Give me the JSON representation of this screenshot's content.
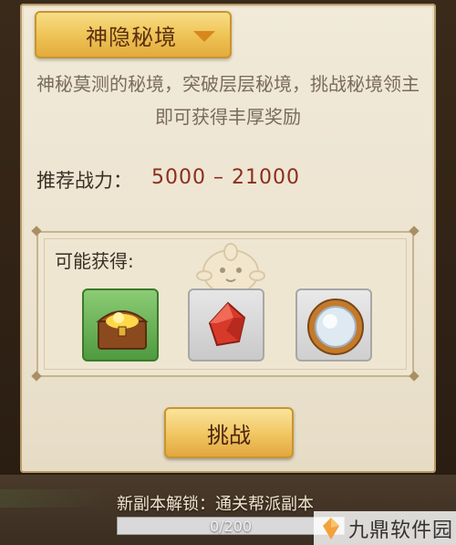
{
  "dialog": {
    "title": "神隐秘境",
    "description": "神秘莫测的秘境，突破层层秘境，挑战秘境领主即可获得丰厚奖励"
  },
  "power": {
    "label": "推荐战力：",
    "value": "5000 – 21000"
  },
  "rewards": {
    "label": "可能获得:",
    "items": [
      {
        "name": "treasure-chest-icon"
      },
      {
        "name": "red-crystal-icon"
      },
      {
        "name": "mirror-orb-icon"
      }
    ]
  },
  "actions": {
    "challenge_label": "挑战"
  },
  "footer": {
    "unlock_text": "新副本解锁：通关帮派副本",
    "progress_text": "0/200",
    "progress_fraction": 0
  },
  "watermark": {
    "text": "九鼎软件园"
  },
  "colors": {
    "accent_gold": "#f0c75b",
    "power_value": "#8b2e1e",
    "progress_fill": "#6dbd3a"
  }
}
